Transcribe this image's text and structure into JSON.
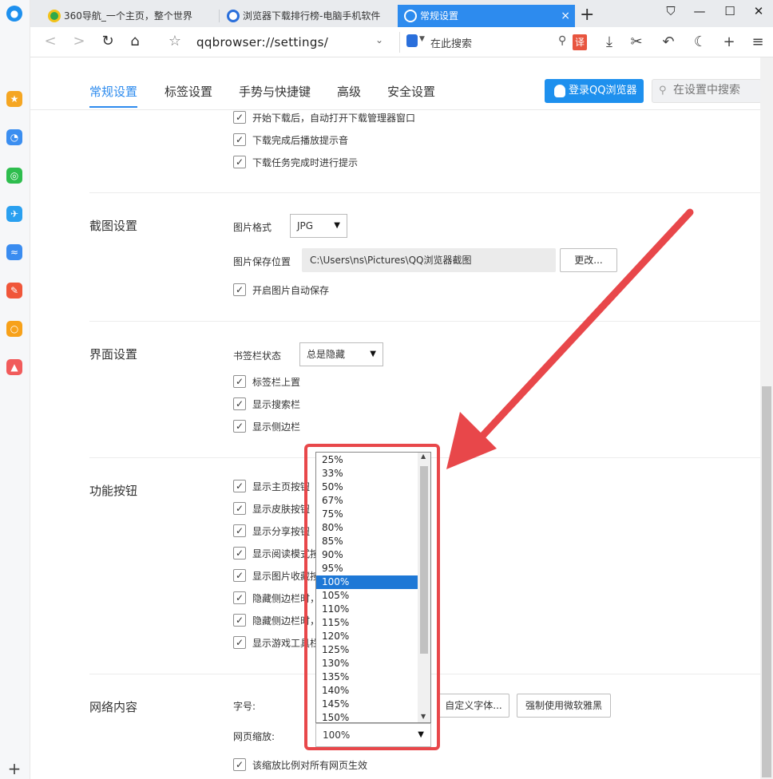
{
  "tabs": [
    {
      "label": "360导航_一个主页，整个世界",
      "icon": "green-360-icon"
    },
    {
      "label": "浏览器下载排行榜-电脑手机软件",
      "icon": "browser-icon"
    },
    {
      "label": "常规设置",
      "icon": "gear-icon",
      "close": "×"
    }
  ],
  "new_tab": "+",
  "address": {
    "url": "qqbrowser://settings/",
    "search_placeholder": "在此搜索",
    "translate": "译"
  },
  "settings_tabs": [
    "常规设置",
    "标签设置",
    "手势与快捷键",
    "高级",
    "安全设置"
  ],
  "login_button": "登录QQ浏览器",
  "settings_search_placeholder": "在设置中搜索",
  "download": {
    "options": [
      "开始下载后，自动打开下载管理器窗口",
      "下载完成后播放提示音",
      "下载任务完成时进行提示"
    ]
  },
  "screenshot": {
    "title": "截图设置",
    "format_label": "图片格式",
    "format_value": "JPG",
    "save_label": "图片保存位置",
    "save_path": "C:\\Users\\ns\\Pictures\\QQ浏览器截图",
    "change_button": "更改...",
    "autosave": "开启图片自动保存"
  },
  "interface": {
    "title": "界面设置",
    "bookmark_label": "书签栏状态",
    "bookmark_value": "总是隐藏",
    "options": [
      "标签栏上置",
      "显示搜索栏",
      "显示侧边栏"
    ]
  },
  "function_buttons": {
    "title": "功能按钮",
    "options": [
      "显示主页按钮",
      "显示皮肤按钮",
      "显示分享按钮",
      "显示阅读模式按",
      "显示图片收藏按",
      "隐藏侧边栏时，",
      "隐藏侧边栏时，",
      "显示游戏工具栏"
    ]
  },
  "web_content": {
    "title": "网络内容",
    "font_label": "字号:",
    "custom_font_button": "自定义字体...",
    "force_yahei_button": "强制使用微软雅黑",
    "zoom_label": "网页缩放:",
    "zoom_value": "100%",
    "apply_all": "该缩放比例对所有网页生效"
  },
  "zoom_options": [
    "25%",
    "33%",
    "50%",
    "67%",
    "75%",
    "80%",
    "85%",
    "90%",
    "95%",
    "100%",
    "105%",
    "110%",
    "115%",
    "120%",
    "125%",
    "130%",
    "135%",
    "140%",
    "145%",
    "150%"
  ],
  "zoom_selected": "100%",
  "colors": {
    "accent": "#2d8bee",
    "annotation": "#e8474a",
    "selection": "#1e78d6"
  }
}
